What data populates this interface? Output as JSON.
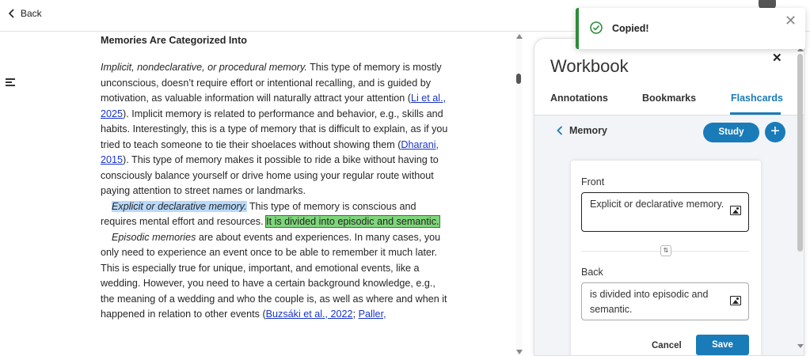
{
  "topbar": {
    "back_label": "Back"
  },
  "article": {
    "heading": "Memories Are Categorized Into",
    "p1": {
      "lead": "Implicit, nondeclarative, or procedural memory.",
      "t1": " This type of memory is mostly unconscious, doesn’t require effort or intentional recalling, and is guided by motivation, as valuable information will naturally attract your attention (",
      "cite1": "Li et al., 2025",
      "t2": "). Implicit memory is related to performance and behavior, e.g., skills and habits. Interestingly, this is a type of memory that is difficult to explain, as if you tried to teach someone to tie their shoelaces without showing them (",
      "cite2": "Dharani, 2015",
      "t3": "). This type of memory makes it possible to ride a bike without having to consciously balance yourself or drive home using your regular route without paying attention to street names or landmarks."
    },
    "p2": {
      "lead": "Explicit or declarative memory.",
      "t1": " This type of memory is conscious and requires mental effort and resources. ",
      "highlight": "It is divided into episodic and semantic."
    },
    "p3": {
      "lead": "Episodic memories",
      "t1": " are about events and experiences. In many cases, you only need to experience an event once to be able to remember it much later. This is especially true for unique, important, and emotional events, like a wedding. However, you need to have a certain background knowledge, e.g., the meaning of a wedding and who the couple is, as well as where and when it happened in relation to other events (",
      "cite1": "Buzsáki et al., 2022",
      "sep": "; ",
      "cite2": "Paller,"
    }
  },
  "workbook": {
    "title": "Workbook",
    "tabs": [
      "Annotations",
      "Bookmarks",
      "Flashcards"
    ],
    "active_tab": "Flashcards",
    "deck_name": "Memory",
    "study_label": "Study",
    "card": {
      "front_label": "Front",
      "front_value": "Explicit or declarative memory.",
      "back_label": "Back",
      "back_value": "is divided into episodic and semantic.",
      "cancel_label": "Cancel",
      "save_label": "Save"
    }
  },
  "toast": {
    "message": "Copied!"
  },
  "colors": {
    "accent": "#1a7bb9",
    "highlight_green": "#7ed67a",
    "highlight_blue": "#b8d9fb",
    "link": "#1a35c9",
    "success": "#2e8b3a"
  }
}
